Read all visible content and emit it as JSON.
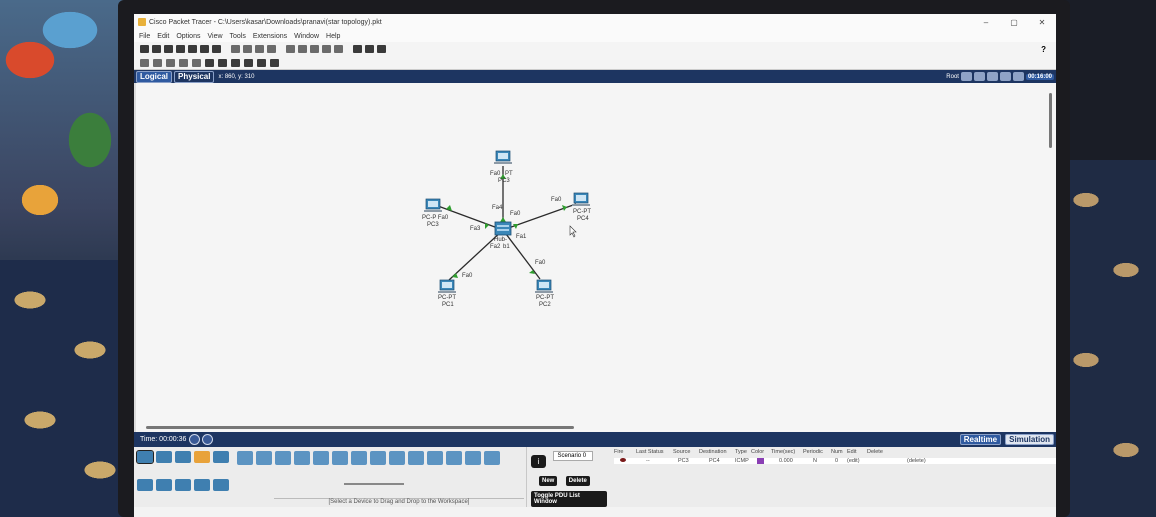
{
  "window": {
    "title": "Cisco Packet Tracer - C:\\Users\\kasar\\Downloads\\pranavi(star topology).pkt",
    "controls": {
      "minimize": "–",
      "maximize": "▢",
      "close": "✕"
    }
  },
  "menu": {
    "items": [
      "File",
      "Edit",
      "Options",
      "View",
      "Tools",
      "Extensions",
      "Window",
      "Help"
    ],
    "help_question": "?"
  },
  "workspace": {
    "tabs": {
      "logical": "Logical",
      "physical": "Physical"
    },
    "coords": "x: 860, y: 310",
    "root_label": "Root",
    "clock": "00:16:00"
  },
  "topology": {
    "hub_label": "Hub-",
    "devices": [
      {
        "id": "pc0",
        "type_label": "PT",
        "name": "PC0",
        "port_at_pc": "Fa0",
        "port_at_hub": "Fa4"
      },
      {
        "id": "pc4",
        "type_label": "PC-PT",
        "name": "PC4",
        "port_at_pc": "Fa0",
        "port_at_hub": "Fa0"
      },
      {
        "id": "pc3",
        "type_label": "PC-P Fa0",
        "name": "PC3",
        "port_at_pc": "",
        "port_at_hub": "Fa3"
      },
      {
        "id": "pc1",
        "type_label": "PC-PT",
        "name": "PC1",
        "port_at_pc": "Fa0",
        "port_at_hub": "Fa2"
      },
      {
        "id": "pc2",
        "type_label": "PC-PT",
        "name": "PC2",
        "port_at_pc": "Fa0",
        "port_at_hub": "Fa1"
      }
    ],
    "pc0_extra": "PC3",
    "hub_port_extra": "b1"
  },
  "realtime_bar": {
    "time": "Time: 00:00:36",
    "realtime_label": "Realtime",
    "simulation_label": "Simulation"
  },
  "bottom_panel": {
    "device_hint": "[Select a Device to Drag and Drop to the Workspace]",
    "scenario": "Scenario 0",
    "info_label": "i",
    "new_label": "New",
    "delete_label": "Delete",
    "toggle_label": "Toggle PDU List Window"
  },
  "pdu_table": {
    "headers": [
      "Fire",
      "Last Status",
      "Source",
      "Destination",
      "Type",
      "Color",
      "Time(sec)",
      "Periodic",
      "Num",
      "Edit",
      "Delete"
    ],
    "rows": [
      {
        "fire": "",
        "status": "--",
        "source": "PC3",
        "destination": "PC4",
        "type": "ICMP",
        "color": "#8a3fb4",
        "time": "0.000",
        "periodic": "N",
        "num": "0",
        "edit": "(edit)",
        "delete": "(delete)"
      }
    ]
  },
  "colors": {
    "accent_bar": "#1d3561",
    "link_green": "#2f9e2f",
    "link_line": "#2b2b2b"
  }
}
